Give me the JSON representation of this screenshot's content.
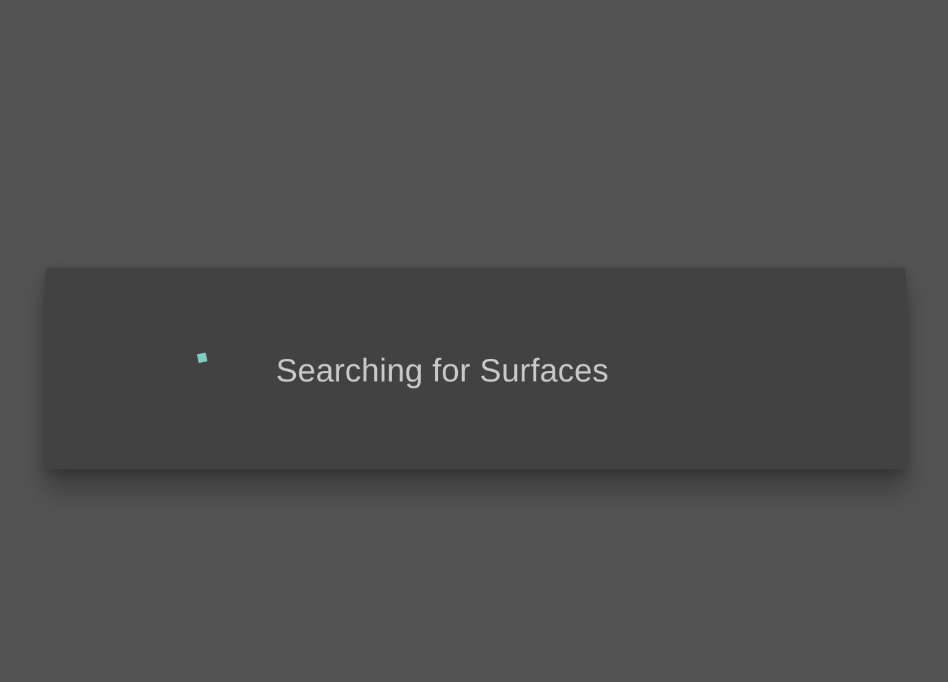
{
  "dialog": {
    "message": "Searching for Surfaces",
    "spinner_icon": "loading-spinner-icon"
  },
  "colors": {
    "background": "#535353",
    "dialog_background": "#424242",
    "text": "#c9c9c9",
    "accent": "#7ecdc4"
  }
}
